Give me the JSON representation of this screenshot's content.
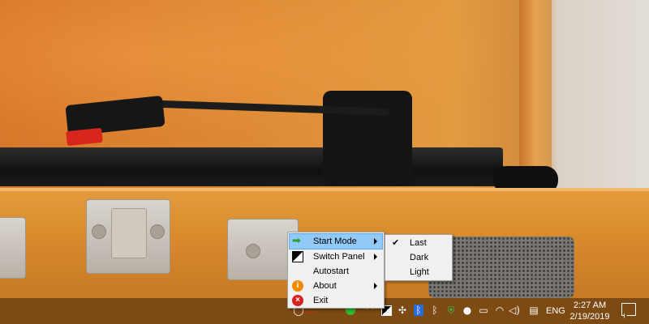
{
  "context_menu": {
    "items": [
      {
        "label": "Start Mode",
        "icon": "green-arrow-icon",
        "has_submenu": true,
        "active": true
      },
      {
        "label": "Switch Panel",
        "icon": "panel-icon",
        "has_submenu": true
      },
      {
        "label": "Autostart",
        "icon": "",
        "has_submenu": false
      },
      {
        "label": "About",
        "icon": "info-icon",
        "has_submenu": true
      },
      {
        "label": "Exit",
        "icon": "exit-icon",
        "has_submenu": false
      }
    ]
  },
  "submenu": {
    "items": [
      {
        "label": "Last",
        "checked": true
      },
      {
        "label": "Dark",
        "checked": false
      },
      {
        "label": "Light",
        "checked": false
      }
    ]
  },
  "taskbar": {
    "language": "ENG",
    "time": "2:27 AM",
    "date": "2/19/2019",
    "tray_icons": [
      "chevron-up-icon",
      "app-icon",
      "dropbox-icon",
      "bluetooth-icon",
      "bluetooth-icon",
      "shield-icon",
      "water-drop-icon",
      "battery-icon",
      "wifi-icon",
      "volume-icon",
      "keyboard-icon"
    ],
    "accent_color": "#7c4a12"
  }
}
